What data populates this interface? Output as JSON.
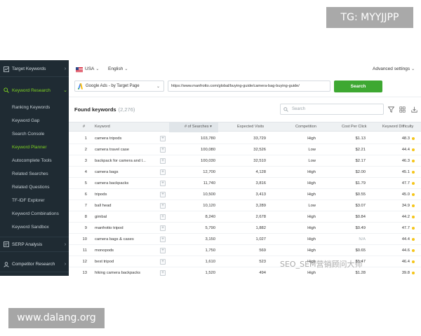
{
  "overlays": {
    "tg_label": "TG: MYYJJPP",
    "site_label": "www.dalang.org",
    "watermark": "SEO_SEM营销顾问大师"
  },
  "sidebar": {
    "target_keywords": "Target Keywords",
    "keyword_research": "Keyword Research",
    "items": [
      {
        "label": "Ranking Keywords"
      },
      {
        "label": "Keyword Gap"
      },
      {
        "label": "Search Console"
      },
      {
        "label": "Keyword Planner"
      },
      {
        "label": "Autocomplete Tools"
      },
      {
        "label": "Related Searches"
      },
      {
        "label": "Related Questions"
      },
      {
        "label": "TF-IDF Explorer"
      },
      {
        "label": "Keyword Combinations"
      },
      {
        "label": "Keyword Sandbox"
      }
    ],
    "serp_analysis": "SERP Analysis",
    "competitor_research": "Competitor Research",
    "active_item": "Keyword Planner"
  },
  "topbar": {
    "country": "USA",
    "language": "English",
    "advanced_settings": "Advanced settings"
  },
  "search": {
    "source": "Google Ads - by Target Page",
    "url": "https://www.manfrotto.com/global/buying-guide/camera-bag-buying-guide/",
    "button": "Search"
  },
  "found": {
    "title": "Found keywords",
    "count": "(2,276)",
    "search_placeholder": "Search"
  },
  "table": {
    "headers": {
      "num": "#",
      "keyword": "Keyword",
      "searches": "# of Searches",
      "visits": "Expected Visits",
      "competition": "Competition",
      "cpc": "Cost Per Click",
      "kd": "Keyword Difficulty"
    },
    "sort_indicator": "▾",
    "rows": [
      {
        "n": "1",
        "keyword": "camera tripods",
        "searches": "103,780",
        "visits": "33,729",
        "competition": "High",
        "cpc": "$1.13",
        "kd": "48.3"
      },
      {
        "n": "2",
        "keyword": "camera travel case",
        "searches": "100,080",
        "visits": "32,526",
        "competition": "Low",
        "cpc": "$2.21",
        "kd": "44.4"
      },
      {
        "n": "3",
        "keyword": "backpack for camera and l...",
        "searches": "100,030",
        "visits": "32,510",
        "competition": "Low",
        "cpc": "$2.17",
        "kd": "46.3"
      },
      {
        "n": "4",
        "keyword": "camera bags",
        "searches": "12,700",
        "visits": "4,128",
        "competition": "High",
        "cpc": "$2.00",
        "kd": "45.1"
      },
      {
        "n": "5",
        "keyword": "camera backpacks",
        "searches": "11,740",
        "visits": "3,816",
        "competition": "High",
        "cpc": "$1.79",
        "kd": "47.7"
      },
      {
        "n": "6",
        "keyword": "tripods",
        "searches": "10,500",
        "visits": "3,413",
        "competition": "High",
        "cpc": "$0.55",
        "kd": "45.0"
      },
      {
        "n": "7",
        "keyword": "ball head",
        "searches": "10,120",
        "visits": "3,289",
        "competition": "Low",
        "cpc": "$3.07",
        "kd": "34.9"
      },
      {
        "n": "8",
        "keyword": "gimbal",
        "searches": "8,240",
        "visits": "2,678",
        "competition": "High",
        "cpc": "$0.84",
        "kd": "44.2"
      },
      {
        "n": "9",
        "keyword": "manfrotto tripod",
        "searches": "5,790",
        "visits": "1,882",
        "competition": "High",
        "cpc": "$0.49",
        "kd": "47.7"
      },
      {
        "n": "10",
        "keyword": "camera bags & cases",
        "searches": "3,150",
        "visits": "1,027",
        "competition": "High",
        "cpc": "N/A",
        "kd": "44.4"
      },
      {
        "n": "11",
        "keyword": "monopods",
        "searches": "1,750",
        "visits": "569",
        "competition": "High",
        "cpc": "$0.65",
        "kd": "44.6"
      },
      {
        "n": "12",
        "keyword": "best tripod",
        "searches": "1,610",
        "visits": "523",
        "competition": "High",
        "cpc": "$1.47",
        "kd": "46.4"
      },
      {
        "n": "13",
        "keyword": "hiking camera backpacks",
        "searches": "1,520",
        "visits": "494",
        "competition": "High",
        "cpc": "$1.28",
        "kd": "39.8"
      }
    ]
  },
  "colors": {
    "sidebar_bg": "#1f2b33",
    "accent_green": "#3ea832",
    "active_text": "#7ed321",
    "kd_dot": "#f5c518"
  }
}
